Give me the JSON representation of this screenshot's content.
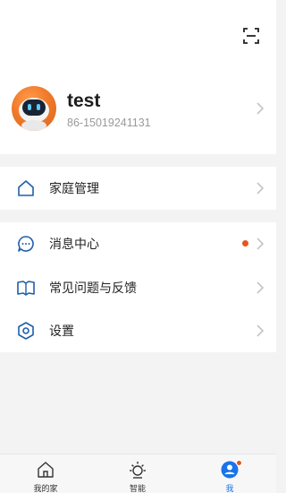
{
  "header": {
    "scan_icon": "scan-icon"
  },
  "profile": {
    "name": "test",
    "phone": "86-15019241131",
    "avatar_icon": "robot-avatar"
  },
  "menu": {
    "home_management": {
      "label": "家庭管理",
      "icon": "home-icon"
    },
    "message_center": {
      "label": "消息中心",
      "icon": "chat-icon",
      "has_unread": true
    },
    "faq_feedback": {
      "label": "常见问题与反馈",
      "icon": "book-icon"
    },
    "settings": {
      "label": "设置",
      "icon": "settings-icon"
    }
  },
  "tabbar": {
    "tabs": [
      {
        "label": "我的家",
        "icon": "home-icon",
        "active": false
      },
      {
        "label": "智能",
        "icon": "sun-icon",
        "active": false
      },
      {
        "label": "我",
        "icon": "user-icon",
        "active": true,
        "badge": true
      }
    ]
  },
  "colors": {
    "accent": "#1a73e8",
    "badge": "#e8541e",
    "avatar": "#f07a2a",
    "icon_blue": "#1f5fa8"
  }
}
